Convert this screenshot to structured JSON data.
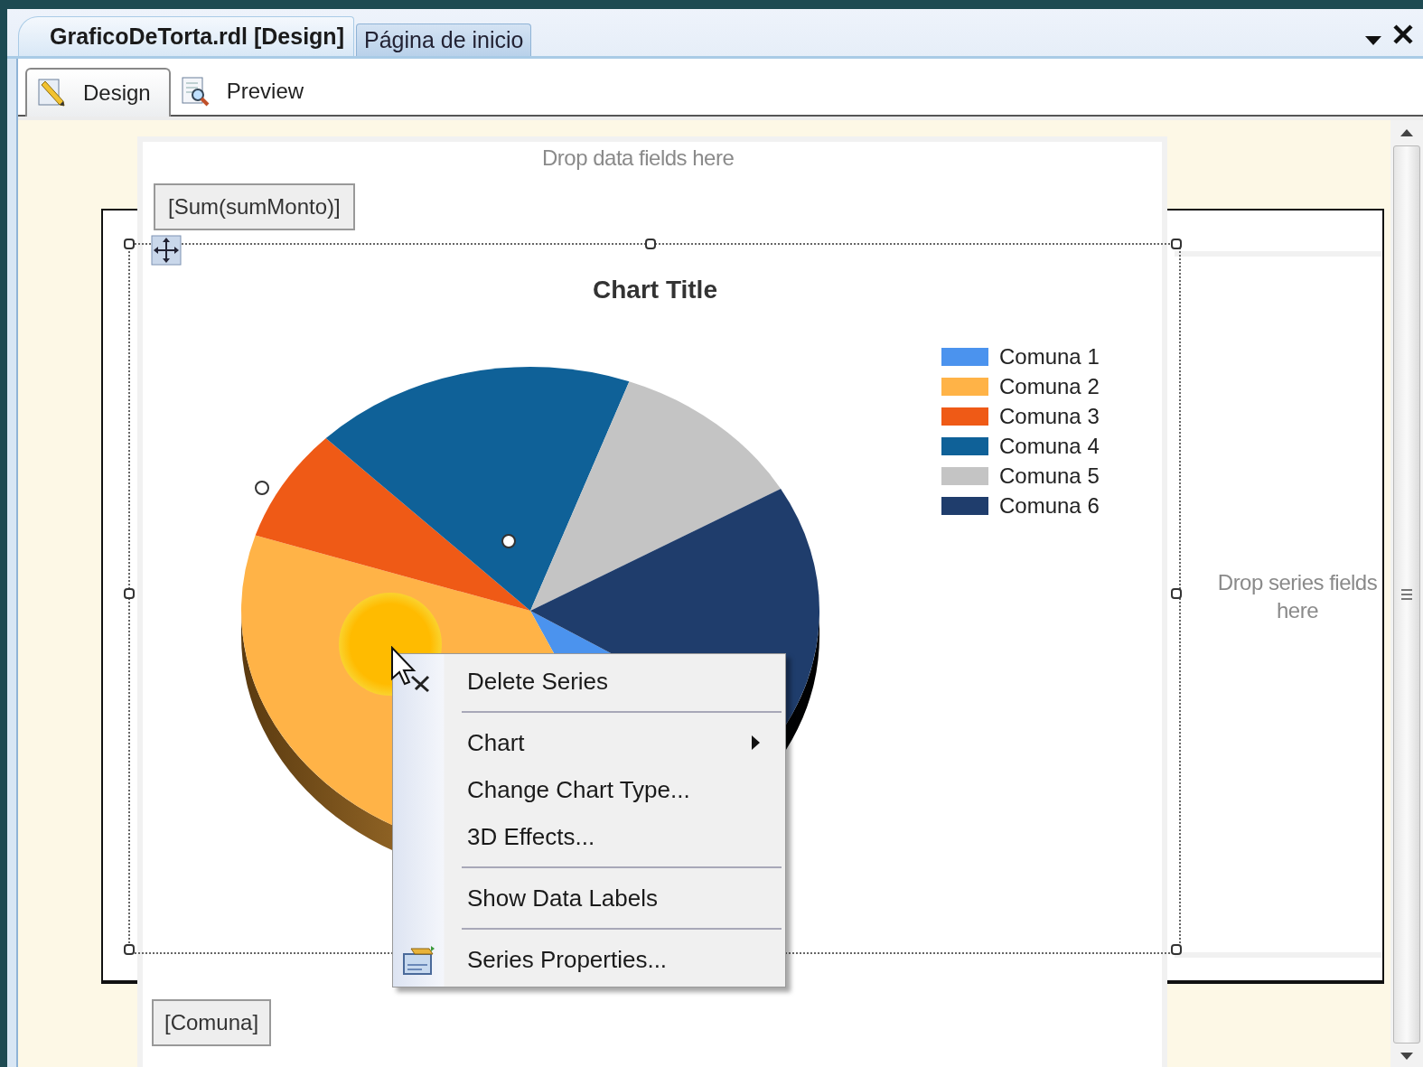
{
  "document_tabs": [
    {
      "label": "GraficoDeTorta.rdl [Design]",
      "selected": true
    },
    {
      "label": "Página de inicio",
      "selected": false
    }
  ],
  "view_tabs": [
    {
      "label": "Design",
      "kind": "design",
      "selected": true
    },
    {
      "label": "Preview",
      "kind": "preview",
      "selected": false
    }
  ],
  "data_drop_zone": "Drop data fields here",
  "data_field": "[Sum(sumMonto)]",
  "series_drop_zone": "Drop series fields here",
  "category_field": "[Comuna]",
  "chart": {
    "title": "Chart Title",
    "legend": [
      {
        "label": "Comuna 1",
        "color": "#4b93ee"
      },
      {
        "label": "Comuna 2",
        "color": "#ffb347"
      },
      {
        "label": "Comuna 3",
        "color": "#ef5a16"
      },
      {
        "label": "Comuna 4",
        "color": "#0f6198"
      },
      {
        "label": "Comuna 5",
        "color": "#c4c4c4"
      },
      {
        "label": "Comuna 6",
        "color": "#1f3d6c"
      }
    ]
  },
  "context_menu": {
    "items": [
      {
        "kind": "item",
        "label": "Delete Series"
      },
      {
        "kind": "separator"
      },
      {
        "kind": "submenu",
        "label": "Chart"
      },
      {
        "kind": "item",
        "label": "Change Chart Type..."
      },
      {
        "kind": "item",
        "label": "3D Effects..."
      },
      {
        "kind": "separator"
      },
      {
        "kind": "item",
        "label": "Show Data Labels"
      },
      {
        "kind": "separator"
      },
      {
        "kind": "icon_item",
        "label": "Series Properties..."
      }
    ]
  }
}
